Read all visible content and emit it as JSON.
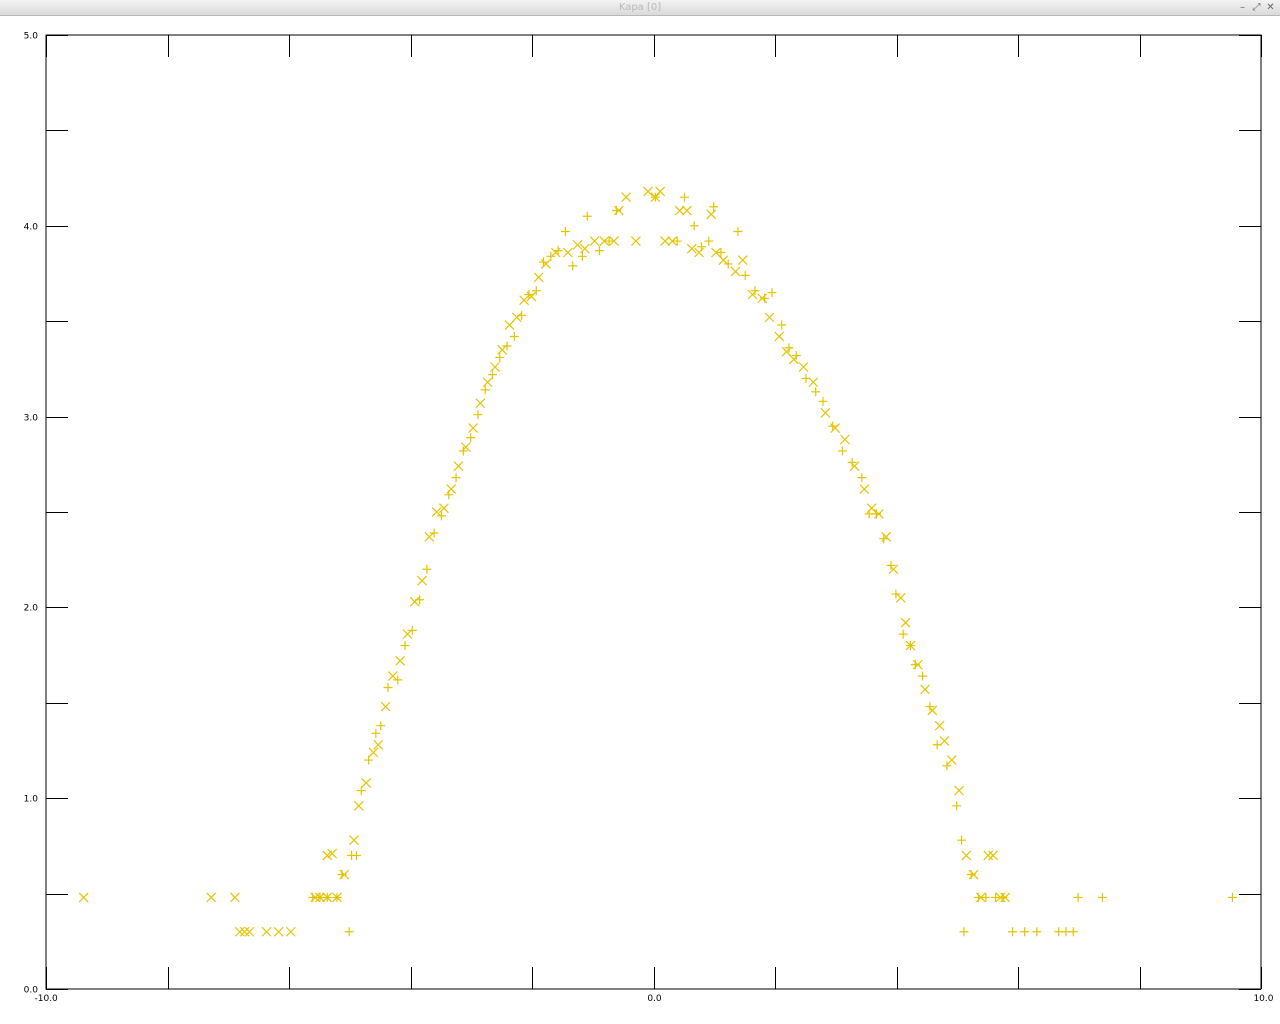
{
  "window": {
    "title": "Kapa [0]",
    "buttons": {
      "minimize": "–",
      "maximize": "⤢",
      "close": "✕"
    }
  },
  "colors": {
    "points": "#e6c300",
    "axes": "#000000",
    "background": "#ffffff"
  },
  "chart_data": {
    "type": "scatter",
    "title": "",
    "xlabel": "",
    "ylabel": "",
    "xlim": [
      -10.0,
      10.0
    ],
    "ylim": [
      0.0,
      5.0
    ],
    "grid": false,
    "x_ticks": [
      {
        "value": -10,
        "label": "-10.0"
      },
      {
        "value": -8
      },
      {
        "value": -6
      },
      {
        "value": -4
      },
      {
        "value": -2
      },
      {
        "value": 0,
        "label": "0.0"
      },
      {
        "value": 2
      },
      {
        "value": 4
      },
      {
        "value": 6
      },
      {
        "value": 8
      },
      {
        "value": 10,
        "label": "10.0"
      }
    ],
    "y_ticks": [
      {
        "value": 0,
        "label": "0.0"
      },
      {
        "value": 0.5
      },
      {
        "value": 1.0,
        "label": "1.0"
      },
      {
        "value": 1.5
      },
      {
        "value": 2.0,
        "label": "2.0"
      },
      {
        "value": 2.5
      },
      {
        "value": 3.0,
        "label": "3.0"
      },
      {
        "value": 3.5
      },
      {
        "value": 4.0,
        "label": "4.0"
      },
      {
        "value": 4.5
      },
      {
        "value": 5.0,
        "label": "5.0"
      }
    ],
    "series": [
      {
        "marker": "x",
        "points": [
          [
            -9.38,
            0.48
          ],
          [
            -7.28,
            0.48
          ],
          [
            -6.89,
            0.48
          ],
          [
            -6.81,
            0.3
          ],
          [
            -6.73,
            0.3
          ],
          [
            -6.65,
            0.3
          ],
          [
            -6.37,
            0.3
          ],
          [
            -6.17,
            0.3
          ],
          [
            -5.97,
            0.3
          ],
          [
            -5.57,
            0.48
          ],
          [
            -5.49,
            0.48
          ],
          [
            -5.37,
            0.48
          ],
          [
            -5.21,
            0.48
          ],
          [
            -5.37,
            0.7
          ],
          [
            -5.29,
            0.71
          ],
          [
            -5.09,
            0.6
          ],
          [
            -4.93,
            0.78
          ],
          [
            -4.85,
            0.96
          ],
          [
            -4.73,
            1.08
          ],
          [
            -4.61,
            1.24
          ],
          [
            -4.53,
            1.28
          ],
          [
            -4.41,
            1.48
          ],
          [
            -4.29,
            1.64
          ],
          [
            -4.17,
            1.72
          ],
          [
            -4.05,
            1.86
          ],
          [
            -3.93,
            2.03
          ],
          [
            -3.81,
            2.14
          ],
          [
            -3.69,
            2.37
          ],
          [
            -3.57,
            2.5
          ],
          [
            -3.45,
            2.52
          ],
          [
            -3.33,
            2.62
          ],
          [
            -3.21,
            2.74
          ],
          [
            -3.09,
            2.84
          ],
          [
            -2.97,
            2.94
          ],
          [
            -2.85,
            3.07
          ],
          [
            -2.73,
            3.18
          ],
          [
            -2.61,
            3.26
          ],
          [
            -2.49,
            3.35
          ],
          [
            -2.37,
            3.48
          ],
          [
            -2.25,
            3.52
          ],
          [
            -2.13,
            3.61
          ],
          [
            -2.01,
            3.63
          ],
          [
            -1.89,
            3.73
          ],
          [
            -1.77,
            3.8
          ],
          [
            -1.61,
            3.86
          ],
          [
            -1.41,
            3.86
          ],
          [
            -1.25,
            3.9
          ],
          [
            -1.13,
            3.88
          ],
          [
            -0.97,
            3.92
          ],
          [
            -0.81,
            3.92
          ],
          [
            -0.65,
            3.92
          ],
          [
            -0.57,
            4.08
          ],
          [
            -0.45,
            4.15
          ],
          [
            -0.29,
            3.92
          ],
          [
            -0.09,
            4.18
          ],
          [
            0.03,
            4.15
          ],
          [
            0.11,
            4.18
          ],
          [
            0.19,
            3.92
          ],
          [
            0.31,
            3.92
          ],
          [
            0.43,
            4.08
          ],
          [
            0.55,
            4.08
          ],
          [
            0.63,
            3.88
          ],
          [
            0.75,
            3.86
          ],
          [
            0.95,
            4.06
          ],
          [
            1.03,
            3.86
          ],
          [
            1.15,
            3.82
          ],
          [
            1.35,
            3.76
          ],
          [
            1.47,
            3.82
          ],
          [
            1.63,
            3.64
          ],
          [
            1.79,
            3.62
          ],
          [
            1.91,
            3.52
          ],
          [
            2.07,
            3.42
          ],
          [
            2.19,
            3.34
          ],
          [
            2.31,
            3.3
          ],
          [
            2.47,
            3.26
          ],
          [
            2.63,
            3.18
          ],
          [
            2.83,
            3.02
          ],
          [
            2.99,
            2.94
          ],
          [
            3.15,
            2.88
          ],
          [
            3.31,
            2.74
          ],
          [
            3.47,
            2.62
          ],
          [
            3.59,
            2.52
          ],
          [
            3.71,
            2.49
          ],
          [
            3.83,
            2.37
          ],
          [
            3.95,
            2.2
          ],
          [
            4.07,
            2.05
          ],
          [
            4.15,
            1.92
          ],
          [
            4.23,
            1.8
          ],
          [
            4.35,
            1.7
          ],
          [
            4.47,
            1.57
          ],
          [
            4.59,
            1.46
          ],
          [
            4.71,
            1.38
          ],
          [
            4.79,
            1.3
          ],
          [
            4.91,
            1.2
          ],
          [
            5.03,
            1.04
          ],
          [
            5.15,
            0.7
          ],
          [
            5.27,
            0.6
          ],
          [
            5.39,
            0.48
          ],
          [
            5.51,
            0.7
          ],
          [
            5.59,
            0.7
          ],
          [
            5.71,
            0.48
          ],
          [
            5.79,
            0.48
          ]
        ]
      },
      {
        "marker": "+",
        "points": [
          [
            -5.61,
            0.48
          ],
          [
            -5.49,
            0.48
          ],
          [
            -5.37,
            0.48
          ],
          [
            -5.21,
            0.48
          ],
          [
            -5.13,
            0.6
          ],
          [
            -5.01,
            0.3
          ],
          [
            -4.97,
            0.7
          ],
          [
            -4.89,
            0.7
          ],
          [
            -4.81,
            1.04
          ],
          [
            -4.69,
            1.2
          ],
          [
            -4.57,
            1.34
          ],
          [
            -4.49,
            1.38
          ],
          [
            -4.37,
            1.58
          ],
          [
            -4.21,
            1.62
          ],
          [
            -4.09,
            1.8
          ],
          [
            -3.97,
            1.88
          ],
          [
            -3.85,
            2.04
          ],
          [
            -3.73,
            2.2
          ],
          [
            -3.61,
            2.39
          ],
          [
            -3.49,
            2.48
          ],
          [
            -3.37,
            2.59
          ],
          [
            -3.25,
            2.68
          ],
          [
            -3.13,
            2.82
          ],
          [
            -3.01,
            2.89
          ],
          [
            -2.89,
            3.01
          ],
          [
            -2.77,
            3.14
          ],
          [
            -2.65,
            3.22
          ],
          [
            -2.53,
            3.31
          ],
          [
            -2.41,
            3.37
          ],
          [
            -2.29,
            3.42
          ],
          [
            -2.17,
            3.53
          ],
          [
            -2.05,
            3.64
          ],
          [
            -1.93,
            3.66
          ],
          [
            -1.81,
            3.81
          ],
          [
            -1.69,
            3.84
          ],
          [
            -1.57,
            3.87
          ],
          [
            -1.45,
            3.97
          ],
          [
            -1.33,
            3.79
          ],
          [
            -1.17,
            3.84
          ],
          [
            -1.09,
            4.05
          ],
          [
            -0.89,
            3.87
          ],
          [
            -0.73,
            3.92
          ],
          [
            -0.61,
            4.08
          ],
          [
            0.03,
            4.15
          ],
          [
            0.39,
            3.92
          ],
          [
            0.51,
            4.15
          ],
          [
            0.67,
            4.0
          ],
          [
            0.79,
            3.89
          ],
          [
            0.91,
            3.92
          ],
          [
            0.99,
            4.1
          ],
          [
            1.11,
            3.86
          ],
          [
            1.23,
            3.8
          ],
          [
            1.39,
            3.97
          ],
          [
            1.51,
            3.74
          ],
          [
            1.67,
            3.66
          ],
          [
            1.83,
            3.62
          ],
          [
            1.95,
            3.65
          ],
          [
            2.11,
            3.48
          ],
          [
            2.23,
            3.36
          ],
          [
            2.35,
            3.32
          ],
          [
            2.51,
            3.2
          ],
          [
            2.67,
            3.13
          ],
          [
            2.79,
            3.08
          ],
          [
            2.95,
            2.95
          ],
          [
            3.11,
            2.82
          ],
          [
            3.27,
            2.76
          ],
          [
            3.43,
            2.68
          ],
          [
            3.55,
            2.49
          ],
          [
            3.67,
            2.49
          ],
          [
            3.79,
            2.36
          ],
          [
            3.91,
            2.22
          ],
          [
            3.99,
            2.07
          ],
          [
            4.11,
            1.86
          ],
          [
            4.23,
            1.8
          ],
          [
            4.31,
            1.7
          ],
          [
            4.43,
            1.64
          ],
          [
            4.55,
            1.48
          ],
          [
            4.67,
            1.28
          ],
          [
            4.83,
            1.17
          ],
          [
            4.99,
            0.96
          ],
          [
            5.07,
            0.78
          ],
          [
            5.11,
            0.3
          ],
          [
            5.23,
            0.6
          ],
          [
            5.35,
            0.48
          ],
          [
            5.47,
            0.48
          ],
          [
            5.63,
            0.48
          ],
          [
            5.75,
            0.48
          ],
          [
            5.91,
            0.3
          ],
          [
            6.11,
            0.3
          ],
          [
            6.31,
            0.3
          ],
          [
            6.67,
            0.3
          ],
          [
            6.79,
            0.3
          ],
          [
            6.91,
            0.3
          ],
          [
            6.99,
            0.48
          ],
          [
            7.39,
            0.48
          ],
          [
            9.53,
            0.48
          ]
        ]
      }
    ]
  }
}
